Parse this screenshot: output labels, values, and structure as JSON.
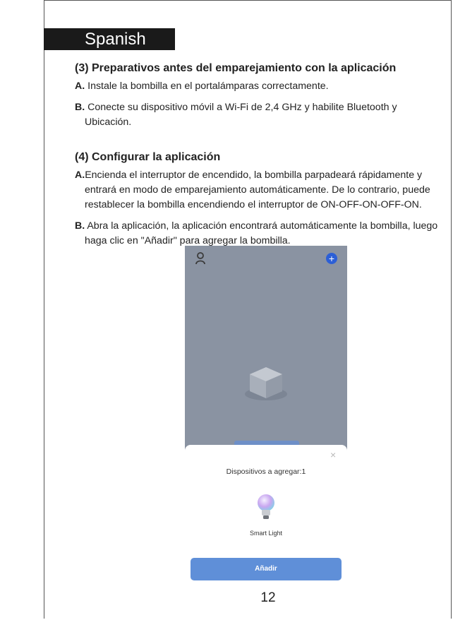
{
  "language_tab": "Spanish",
  "section3": {
    "heading": "(3) Preparativos antes del emparejamiento con la aplicación",
    "items": [
      {
        "marker": "A.",
        "text": " Instale la bombilla en el portalámparas correctamente."
      },
      {
        "marker": "B.",
        "text": " Conecte su dispositivo móvil a Wi-Fi de 2,4 GHz y habilite Bluetooth y Ubicación."
      }
    ]
  },
  "section4": {
    "heading": "(4) Configurar la aplicación",
    "items": [
      {
        "marker": "A.",
        "text": "Encienda el interruptor de encendido, la bombilla parpadeará rápidamente y entrará en modo de emparejamiento automáticamente. De lo contrario, puede restablecer la bombilla encendiendo el interruptor de ON-OFF-ON-OFF-ON."
      },
      {
        "marker": "B.",
        "text": " Abra la aplicación, la aplicación encontrará automáticamente la bombilla, luego haga clic en \"Añadir\" para agregar la bombilla."
      }
    ]
  },
  "phone": {
    "plus_icon": "+",
    "close_icon": "×",
    "sheet_title": "Dispositivos a agregar:1",
    "device_name": "Smart Light",
    "add_button": "Añadir"
  },
  "page_number": "12"
}
